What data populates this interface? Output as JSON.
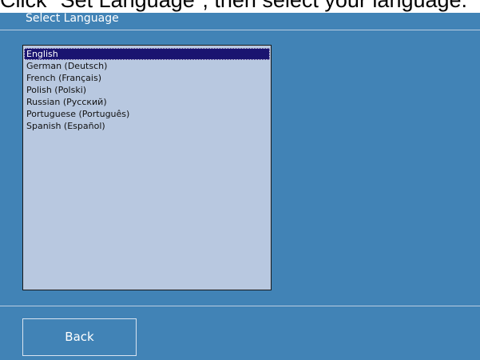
{
  "instruction": {
    "text": "Click \"Set Language\", then select your language."
  },
  "header": {
    "title": "Select Language"
  },
  "language_list": {
    "selected_index": 0,
    "items": [
      {
        "label": "English"
      },
      {
        "label": "German (Deutsch)"
      },
      {
        "label": "French (Français)"
      },
      {
        "label": "Polish (Polski)"
      },
      {
        "label": "Russian (Русский)"
      },
      {
        "label": "Portuguese (Português)"
      },
      {
        "label": "Spanish (Español)"
      }
    ]
  },
  "footer": {
    "back_label": "Back"
  },
  "colors": {
    "panel_background": "#4183b6",
    "list_background": "#b8c8e0",
    "selection_background": "#1a1470",
    "text_light": "#ffffff"
  }
}
